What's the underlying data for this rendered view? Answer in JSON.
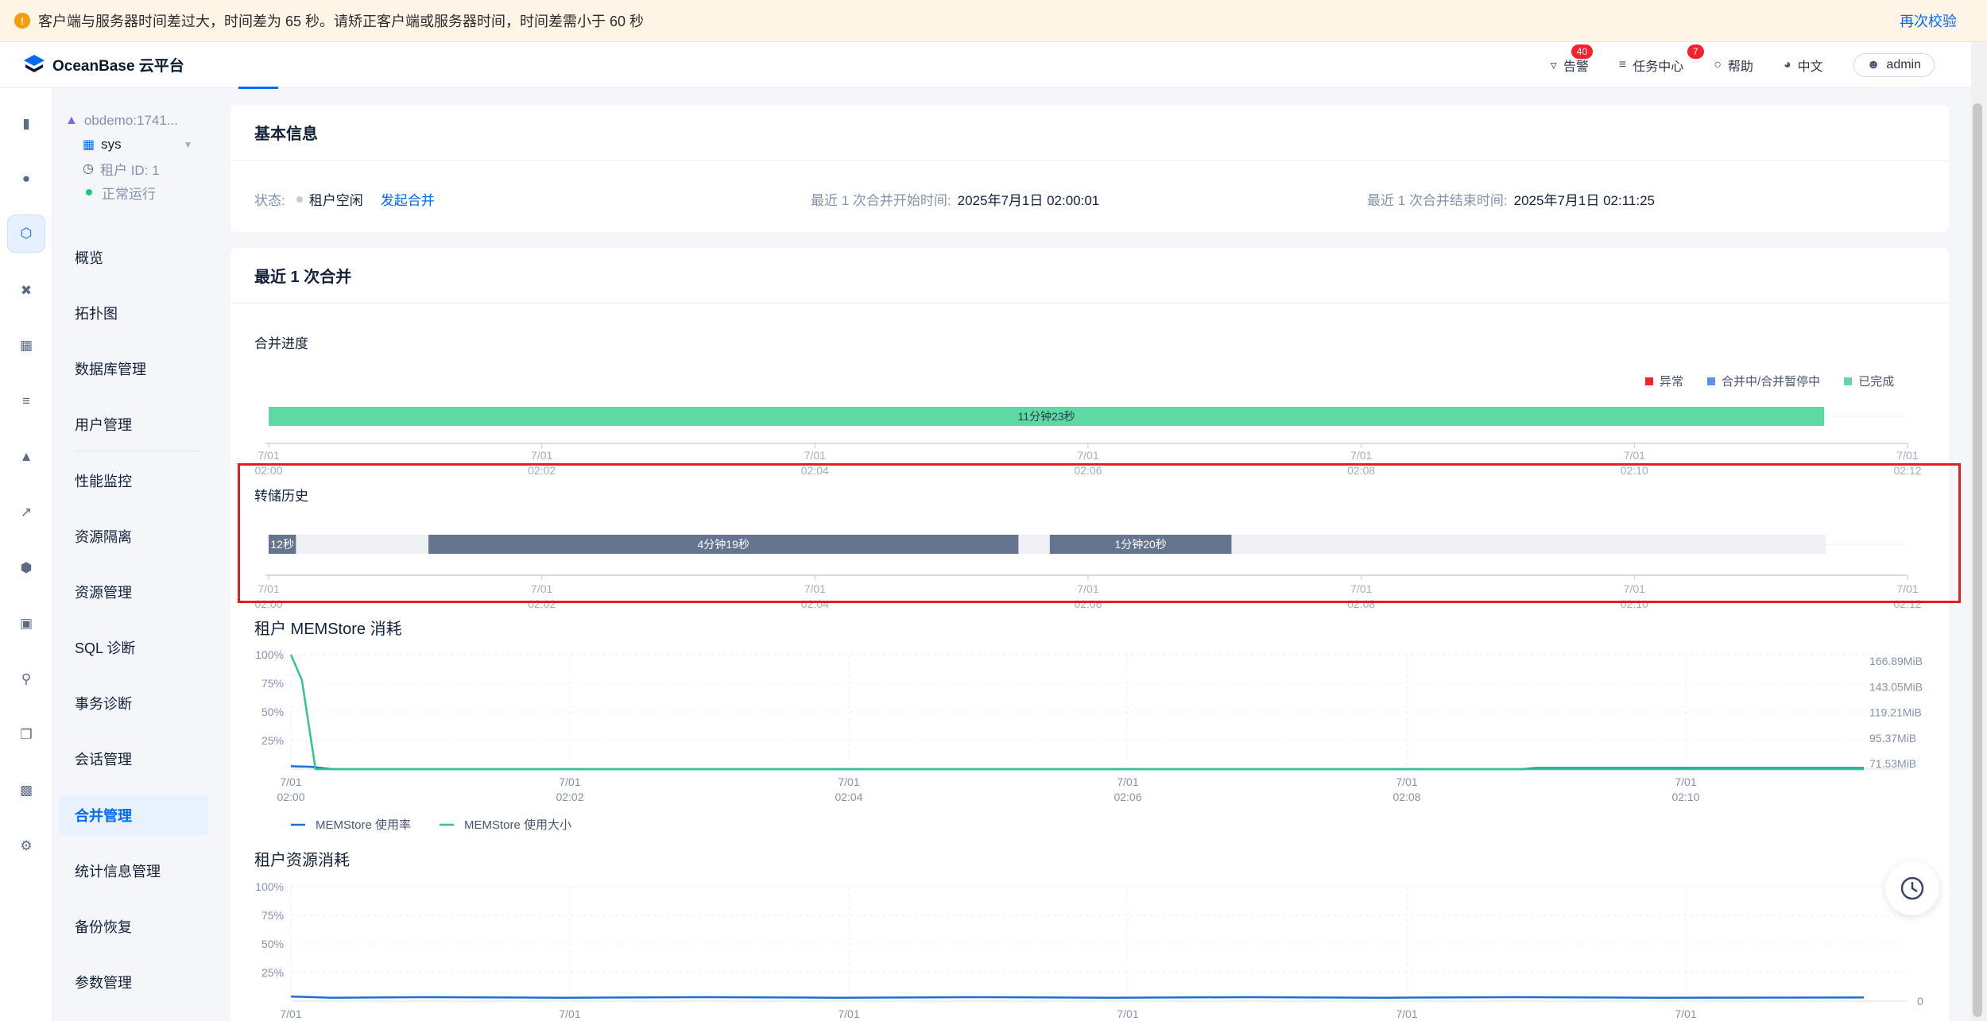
{
  "banner": {
    "message": "客户端与服务器时间差过大，时间差为 65 秒。请矫正客户端或服务器时间，时间差需小于 60 秒",
    "action": "再次校验",
    "warning_color": "#f59e0b"
  },
  "header": {
    "product": "OceanBase 云平台",
    "alerts": {
      "label": "告警",
      "count": "40"
    },
    "tasks": {
      "label": "任务中心",
      "count": "7"
    },
    "help": "帮助",
    "language": "中文",
    "user": "admin"
  },
  "rail_icons": [
    "chart-icon",
    "cluster-icon",
    "tenant-icon",
    "topology-icon",
    "doc-search-icon",
    "list-icon",
    "alarm-icon",
    "trend-icon",
    "shield-icon",
    "package-icon",
    "diagnose-icon",
    "copy-icon",
    "report-icon",
    "settings-sliders-icon"
  ],
  "nav": {
    "cluster": "obdemo:1741...",
    "tenant": "sys",
    "tenant_id": "租户 ID: 1",
    "status": "正常运行",
    "status_color": "#20c57a",
    "items": [
      {
        "label": "概览"
      },
      {
        "label": "拓扑图"
      },
      {
        "label": "数据库管理"
      },
      {
        "label": "用户管理"
      },
      {
        "label": "性能监控"
      },
      {
        "label": "资源隔离"
      },
      {
        "label": "资源管理"
      },
      {
        "label": "SQL 诊断"
      },
      {
        "label": "事务诊断"
      },
      {
        "label": "会话管理"
      },
      {
        "label": "合并管理"
      },
      {
        "label": "统计信息管理"
      },
      {
        "label": "备份恢复"
      },
      {
        "label": "参数管理"
      }
    ],
    "active": "合并管理"
  },
  "basic_info": {
    "title": "基本信息",
    "status_label": "状态:",
    "status_value": "租户空闲",
    "action": "发起合并",
    "start_label": "最近 1 次合并开始时间:",
    "start_value": "2025年7月1日 02:00:01",
    "end_label": "最近 1 次合并结束时间:",
    "end_value": "2025年7月1日 02:11:25"
  },
  "latest_merge": {
    "title": "最近 1 次合并",
    "progress_label": "合并进度",
    "dump_label": "转储历史",
    "legend": [
      {
        "label": "异常",
        "color": "#f5222d"
      },
      {
        "label": "合并中/合并暂停中",
        "color": "#5b8ff9"
      },
      {
        "label": "已完成",
        "color": "#5fd9a4"
      }
    ],
    "time_ticks": [
      {
        "date": "7/01",
        "time": "02:00"
      },
      {
        "date": "7/01",
        "time": "02:02"
      },
      {
        "date": "7/01",
        "time": "02:04"
      },
      {
        "date": "7/01",
        "time": "02:06"
      },
      {
        "date": "7/01",
        "time": "02:08"
      },
      {
        "date": "7/01",
        "time": "02:10"
      },
      {
        "date": "7/01",
        "time": "02:12"
      }
    ]
  },
  "chart_data": [
    {
      "type": "bar",
      "title": "合并进度",
      "x_unit": "minutes after 02:00",
      "xlim": [
        0,
        12
      ],
      "segments": [
        {
          "start": 0,
          "end": 11.39,
          "label": "11分钟23秒",
          "status": "已完成",
          "color": "#5fd9a4"
        }
      ]
    },
    {
      "type": "bar",
      "title": "转储历史",
      "x_unit": "minutes after 02:00",
      "xlim": [
        0,
        12
      ],
      "track_end": 11.4,
      "segments": [
        {
          "start": 0,
          "end": 0.2,
          "label": "12秒",
          "color": "#66758f"
        },
        {
          "start": 1.17,
          "end": 5.49,
          "label": "4分钟19秒",
          "color": "#66758f"
        },
        {
          "start": 5.72,
          "end": 7.05,
          "label": "1分钟20秒",
          "color": "#66758f"
        }
      ]
    },
    {
      "type": "line",
      "title": "租户 MEMStore 消耗",
      "y_ticks_left": [
        "100%",
        "75%",
        "50%",
        "25%"
      ],
      "y_ticks_right": [
        "166.89MiB",
        "143.05MiB",
        "119.21MiB",
        "95.37MiB",
        "71.53MiB"
      ],
      "x_ticks": [
        {
          "date": "7/01",
          "time": "02:00"
        },
        {
          "date": "7/01",
          "time": "02:02"
        },
        {
          "date": "7/01",
          "time": "02:04"
        },
        {
          "date": "7/01",
          "time": "02:06"
        },
        {
          "date": "7/01",
          "time": "02:08"
        },
        {
          "date": "7/01",
          "time": "02:10"
        }
      ],
      "series": [
        {
          "name": "MEMStore 使用率",
          "color": "#1f6fd1",
          "points": [
            [
              0,
              2.5
            ],
            [
              0.15,
              2
            ],
            [
              0.3,
              0
            ],
            [
              6.9,
              0
            ],
            [
              7.0,
              0
            ],
            [
              9,
              0
            ],
            [
              9.1,
              1
            ],
            [
              11.5,
              1
            ]
          ]
        },
        {
          "name": "MEMStore 使用大小",
          "color": "#34c38f",
          "points": [
            [
              0,
              100
            ],
            [
              0.08,
              78
            ],
            [
              0.18,
              0
            ],
            [
              11.5,
              0
            ]
          ]
        }
      ]
    },
    {
      "type": "line",
      "title": "租户资源消耗",
      "y_ticks_left": [
        "100%",
        "75%",
        "50%",
        "25%"
      ],
      "y_ticks_right": [
        "0"
      ],
      "x_ticks": [
        {
          "date": "7/01",
          "time": ""
        },
        {
          "date": "7/01",
          "time": ""
        },
        {
          "date": "7/01",
          "time": ""
        },
        {
          "date": "7/01",
          "time": ""
        },
        {
          "date": "7/01",
          "time": ""
        },
        {
          "date": "7/01",
          "time": ""
        }
      ],
      "series": [
        {
          "name": "",
          "color": "#1f6fd1",
          "points": [
            [
              0,
              4
            ],
            [
              0.3,
              3
            ],
            [
              1,
              3.5
            ],
            [
              2,
              3
            ],
            [
              3,
              3.5
            ],
            [
              4,
              3
            ],
            [
              5,
              3.5
            ],
            [
              6,
              3
            ],
            [
              7,
              3.5
            ],
            [
              8,
              3
            ],
            [
              9,
              3.5
            ],
            [
              10,
              3
            ],
            [
              11.5,
              3.2
            ]
          ]
        }
      ]
    }
  ]
}
